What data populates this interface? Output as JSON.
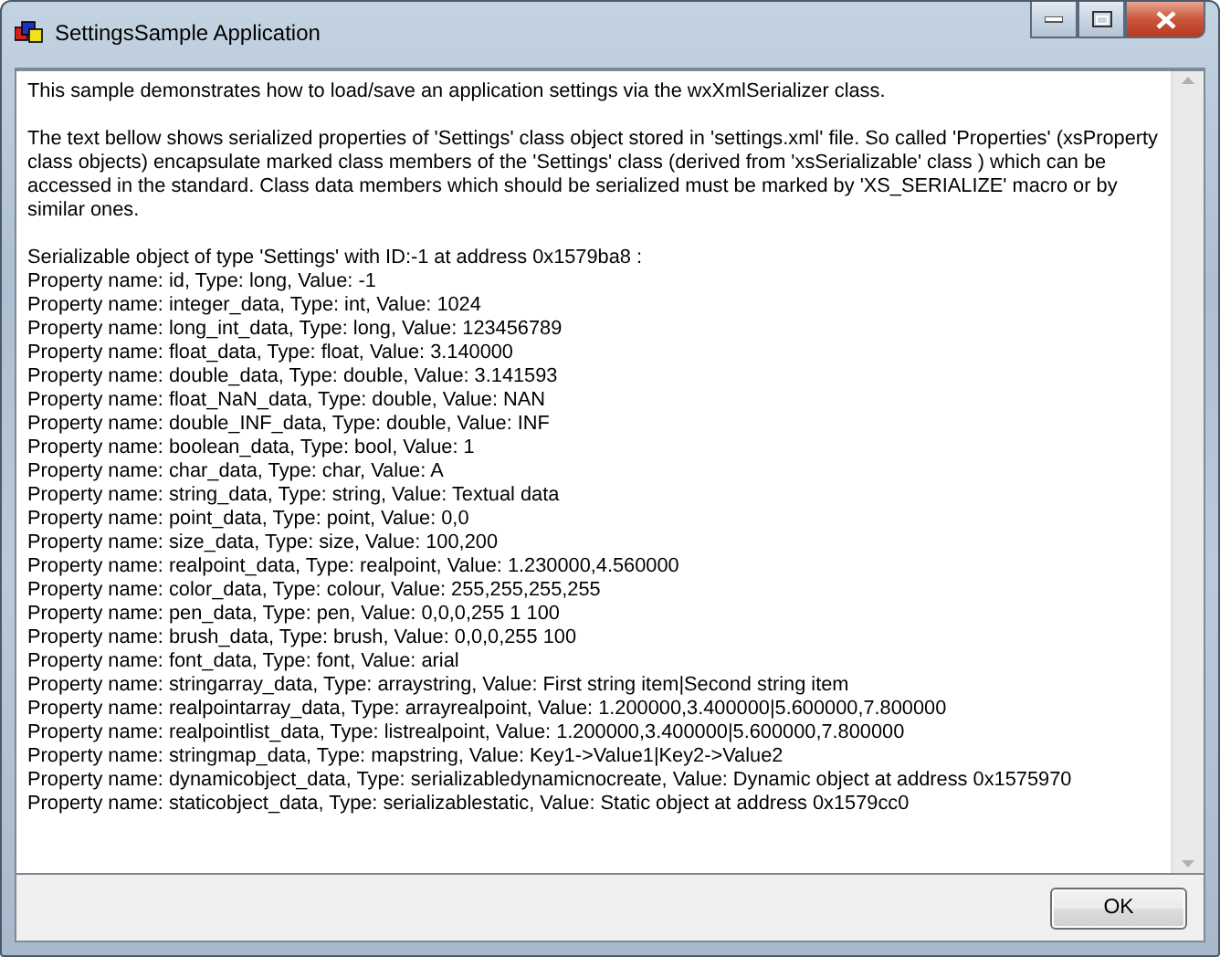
{
  "window": {
    "title": "SettingsSample Application"
  },
  "log": {
    "intro": "This sample demonstrates how to load/save an application settings via the wxXmlSerializer class.",
    "description": "The text bellow shows serialized properties of 'Settings' class object stored in 'settings.xml' file. So called 'Properties' (xsProperty class objects) encapsulate marked class members of the 'Settings' class (derived from 'xsSerializable' class ) which can be accessed in the standard. Class data members which should be serialized must be marked by 'XS_SERIALIZE' macro or by similar ones.",
    "header": "Serializable object of type 'Settings' with ID:-1 at address 0x1579ba8 :",
    "properties": [
      "Property name: id, Type: long, Value: -1",
      "Property name: integer_data, Type: int, Value: 1024",
      "Property name: long_int_data, Type: long, Value: 123456789",
      "Property name: float_data, Type: float, Value: 3.140000",
      "Property name: double_data, Type: double, Value: 3.141593",
      "Property name: float_NaN_data, Type: double, Value: NAN",
      "Property name: double_INF_data, Type: double, Value: INF",
      "Property name: boolean_data, Type: bool, Value: 1",
      "Property name: char_data, Type: char, Value: A",
      "Property name: string_data, Type: string, Value: Textual data",
      "Property name: point_data, Type: point, Value: 0,0",
      "Property name: size_data, Type: size, Value: 100,200",
      "Property name: realpoint_data, Type: realpoint, Value: 1.230000,4.560000",
      "Property name: color_data, Type: colour, Value: 255,255,255,255",
      "Property name: pen_data, Type: pen, Value: 0,0,0,255 1 100",
      "Property name: brush_data, Type: brush, Value: 0,0,0,255 100",
      "Property name: font_data, Type: font, Value: arial",
      "Property name: stringarray_data, Type: arraystring, Value: First string item|Second string item",
      "Property name: realpointarray_data, Type: arrayrealpoint, Value: 1.200000,3.400000|5.600000,7.800000",
      "Property name: realpointlist_data, Type: listrealpoint, Value: 1.200000,3.400000|5.600000,7.800000",
      "Property name: stringmap_data, Type: mapstring, Value: Key1->Value1|Key2->Value2",
      "Property name: dynamicobject_data, Type: serializabledynamicnocreate, Value: Dynamic object at address 0x1575970",
      "Property name: staticobject_data, Type: serializablestatic, Value: Static object at address 0x1579cc0"
    ]
  },
  "buttons": [
    {
      "label": "OK"
    }
  ]
}
